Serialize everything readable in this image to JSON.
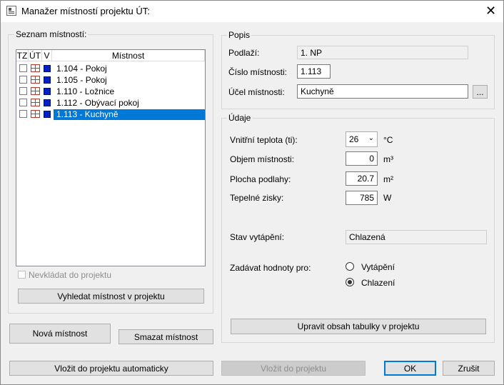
{
  "window": {
    "title": "Manažer místností projektu ÚT:"
  },
  "rooms_group": {
    "label": "Seznam místností:",
    "columns": [
      "TZ",
      "ÚT",
      "V",
      "Místnost"
    ],
    "rows": [
      {
        "name": "1.104 - Pokoj"
      },
      {
        "name": "1.105 - Pokoj"
      },
      {
        "name": "1.110 - Ložnice"
      },
      {
        "name": "1.112 - Obývací pokoj"
      },
      {
        "name": "1.113 - Kuchyně"
      }
    ],
    "selected_row": 4,
    "exclude_label": "Nevkládat do projektu",
    "find_button": "Vyhledat místnost v projektu"
  },
  "popis": {
    "label": "Popis",
    "podlazi_label": "Podlaží:",
    "podlazi_value": "1. NP",
    "cislo_label": "Číslo místnosti:",
    "cislo_value": "1.113",
    "ucel_label": "Účel místnosti:",
    "ucel_value": "Kuchyně",
    "browse": "..."
  },
  "udaje": {
    "label": "Údaje",
    "teplota_label": "Vnitřní teplota (ti):",
    "teplota_value": "26",
    "teplota_unit": "°C",
    "objem_label": "Objem místnosti:",
    "objem_value": "0",
    "objem_unit": "m³",
    "plocha_label": "Plocha podlahy:",
    "plocha_value": "20.7",
    "plocha_unit": "m²",
    "zisky_label": "Tepelné zisky:",
    "zisky_value": "785",
    "zisky_unit": "W",
    "stav_label": "Stav vytápění:",
    "stav_value": "Chlazená",
    "zadavat_label": "Zadávat hodnoty pro:",
    "radio_vytapeni": "Vytápění",
    "radio_chlazeni": "Chlazení",
    "update_button": "Upravit obsah tabulky v projektu"
  },
  "buttons": {
    "new_room": "Nová místnost",
    "delete_room": "Smazat místnost",
    "insert_auto": "Vložit do projektu automaticky",
    "insert": "Vložit do projektu",
    "ok": "OK",
    "cancel": "Zrušit"
  }
}
